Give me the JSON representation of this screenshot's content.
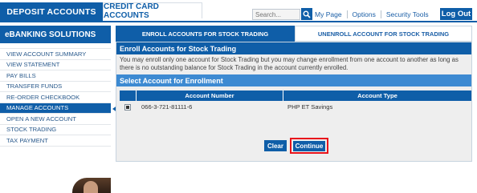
{
  "top_tabs": {
    "deposit": "DEPOSIT ACCOUNTS",
    "credit": "CREDIT CARD ACCOUNTS"
  },
  "header": {
    "search_placeholder": "Search...",
    "links": [
      "My Page",
      "Options",
      "Security Tools"
    ],
    "logout": "Log Out"
  },
  "sidebar": {
    "title": "eBANKING SOLUTIONS",
    "items": [
      {
        "label": "VIEW ACCOUNT SUMMARY"
      },
      {
        "label": "VIEW STATEMENT"
      },
      {
        "label": "PAY BILLS"
      },
      {
        "label": "TRANSFER FUNDS"
      },
      {
        "label": "RE-ORDER CHECKBOOK"
      },
      {
        "label": "MANAGE ACCOUNTS"
      },
      {
        "label": "OPEN A NEW ACCOUNT"
      },
      {
        "label": "STOCK TRADING"
      },
      {
        "label": "TAX PAYMENT"
      }
    ],
    "active_item": "MANAGE ACCOUNTS"
  },
  "sub_tabs": {
    "enroll": "ENROLL ACCOUNTS FOR STOCK TRADING",
    "unenroll": "UNENROLL ACCOUNT FOR STOCK TRADING"
  },
  "panel": {
    "title": "Enroll Accounts for Stock Trading",
    "notice": "You may enroll only one account for Stock Trading but you may change enrollment from one account to another as long as there is no outstanding balance for Stock Trading in the account currently enrolled.",
    "select_title": "Select Account for Enrollment"
  },
  "table": {
    "headers": {
      "account_number": "Account Number",
      "account_type": "Account Type"
    },
    "rows": [
      {
        "account_number": "066-3-721-81111-6",
        "account_type": "PHP ET Savings",
        "selected": true
      }
    ]
  },
  "actions": {
    "clear": "Clear",
    "continue": "Continue"
  },
  "colors": {
    "primary": "#0f5ea8",
    "secondary": "#3d8ad2",
    "highlight_border": "#e8141b"
  }
}
